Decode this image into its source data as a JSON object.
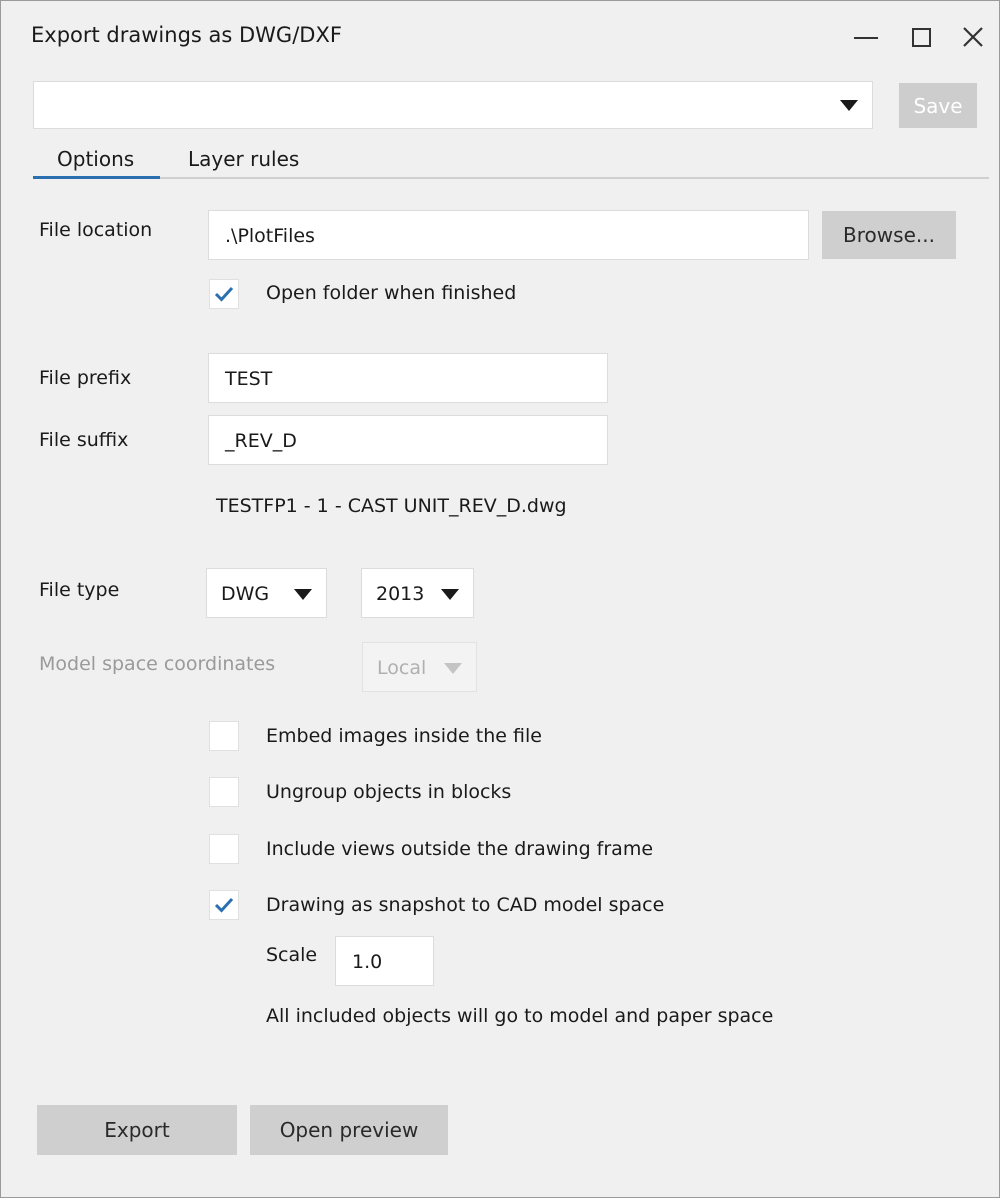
{
  "window": {
    "title": "Export drawings as DWG/DXF",
    "controls": {
      "minimize_icon": "minimize-icon",
      "maximize_icon": "maximize-icon",
      "close_icon": "close-icon",
      "close_glyph": "✕"
    }
  },
  "toolbar": {
    "profile_value": "",
    "save_label": "Save"
  },
  "tabs": [
    {
      "label": "Options",
      "active": true
    },
    {
      "label": "Layer rules",
      "active": false
    }
  ],
  "options": {
    "file_location": {
      "label": "File location",
      "value": ".\\PlotFiles",
      "browse_label": "Browse..."
    },
    "open_folder": {
      "label": "Open folder when finished",
      "checked": true
    },
    "file_prefix": {
      "label": "File prefix",
      "value": "TEST"
    },
    "file_suffix": {
      "label": "File suffix",
      "value": "_REV_D"
    },
    "filename_preview": "TESTFP1 - 1 - CAST UNIT_REV_D.dwg",
    "file_type": {
      "label": "File type",
      "format": "DWG",
      "version": "2013"
    },
    "model_space": {
      "label": "Model space coordinates",
      "value": "Local",
      "enabled": false
    },
    "embed_images": {
      "label": "Embed images inside the file",
      "checked": false
    },
    "ungroup_blocks": {
      "label": "Ungroup objects in blocks",
      "checked": false
    },
    "include_views": {
      "label": "Include views outside the drawing frame",
      "checked": false
    },
    "snapshot": {
      "label": "Drawing as snapshot to CAD model space",
      "checked": true
    },
    "scale": {
      "label": "Scale",
      "value": "1.0"
    },
    "note": "All included objects will go to model and paper space"
  },
  "actions": {
    "export_label": "Export",
    "preview_label": "Open preview"
  },
  "colors": {
    "accent": "#2a6fb0",
    "button_bg": "#cfcfcf",
    "window_bg": "#f0f0f0"
  }
}
